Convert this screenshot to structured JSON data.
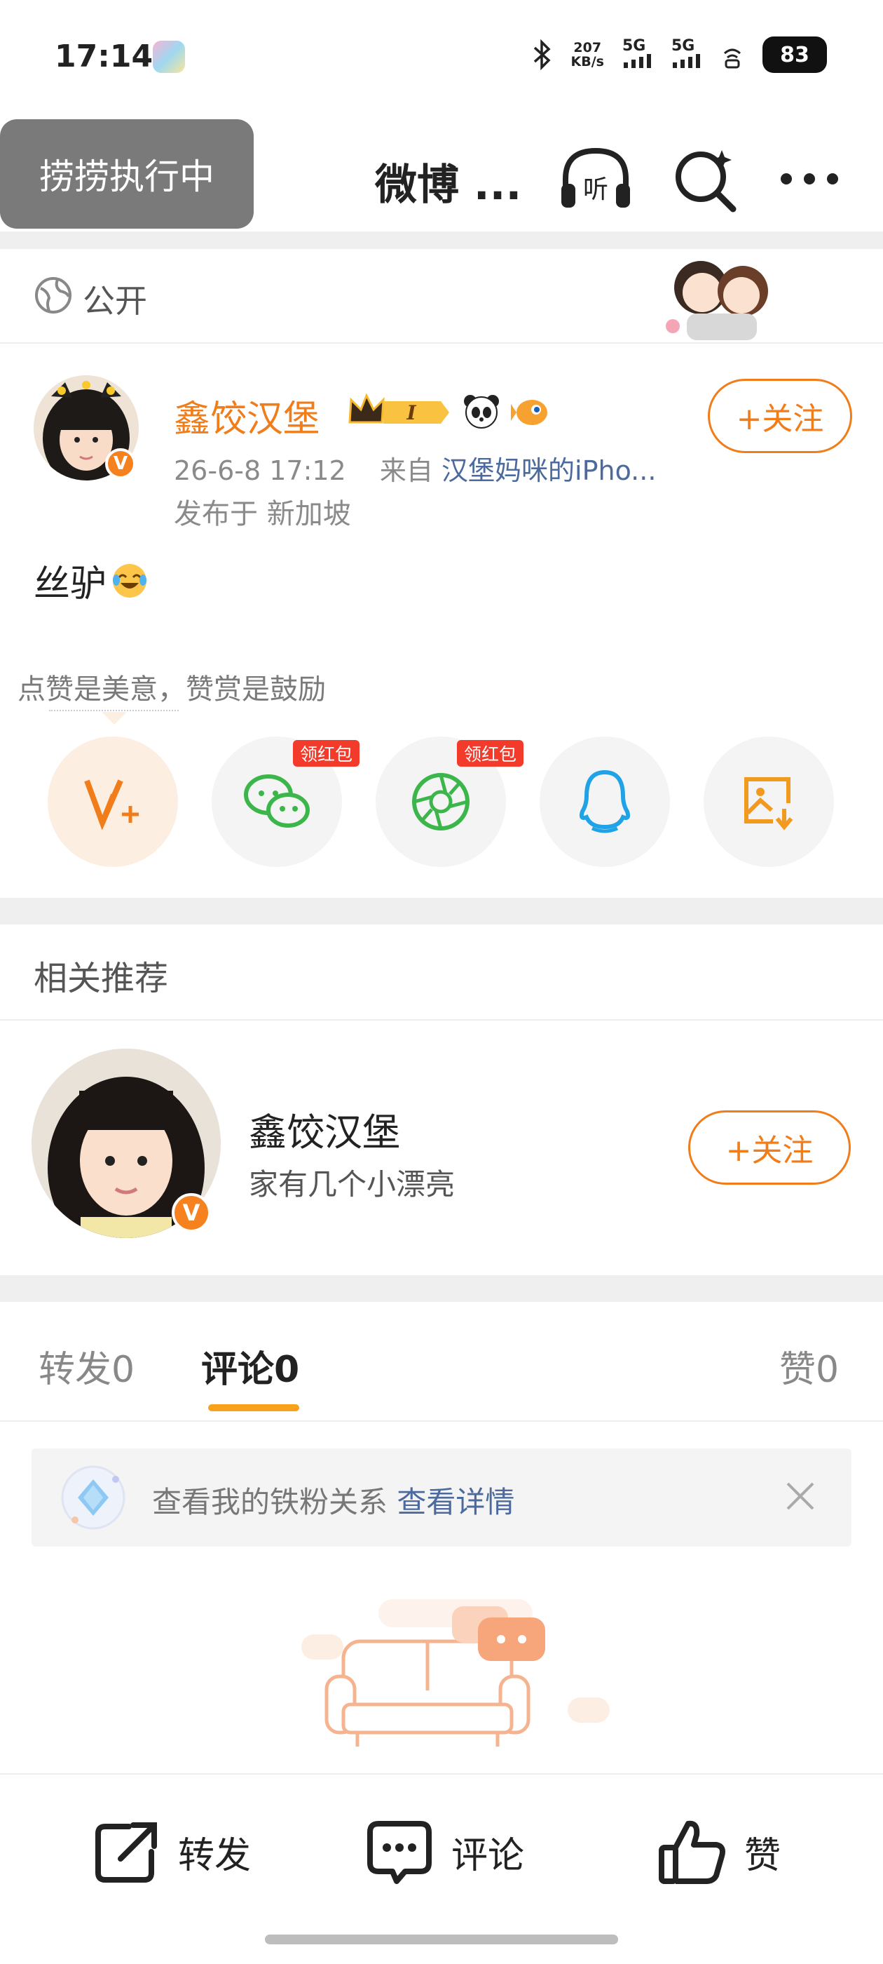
{
  "status_bar": {
    "time": "17:14",
    "net_speed_value": "207",
    "net_speed_unit": "KB/s",
    "sim1": "5G",
    "sim2": "5G",
    "battery": "83"
  },
  "nav": {
    "toast": "捞捞执行中",
    "title": "微博 ..."
  },
  "post": {
    "visibility": "公开",
    "author": "鑫饺汉堡",
    "level_badge": "I",
    "timestamp": "26-6-8 17:12",
    "source_prefix": "来自",
    "source": "汉堡妈咪的iPho...",
    "location_prefix": "发布于",
    "location": "新加坡",
    "text": "丝驴",
    "follow_label": "+关注",
    "reward_hint": "点赞是美意，赞赏是鼓励",
    "share_badge": "领红包"
  },
  "related": {
    "title": "相关推荐",
    "user": {
      "name": "鑫饺汉堡",
      "desc": "家有几个小漂亮",
      "follow_label": "+关注"
    }
  },
  "tabs": {
    "repost": "转发",
    "repost_count": "0",
    "comment": "评论",
    "comment_count": "0",
    "like": "赞",
    "like_count": "0"
  },
  "fan_bar": {
    "text": "查看我的铁粉关系",
    "link": "查看详情"
  },
  "bottom_bar": {
    "repost": "转发",
    "comment": "评论",
    "like": "赞"
  },
  "colors": {
    "accent": "#f07d1a",
    "tab_indicator": "#f8a21c",
    "link": "#4c6a9e",
    "red_badge": "#f33b2c"
  }
}
